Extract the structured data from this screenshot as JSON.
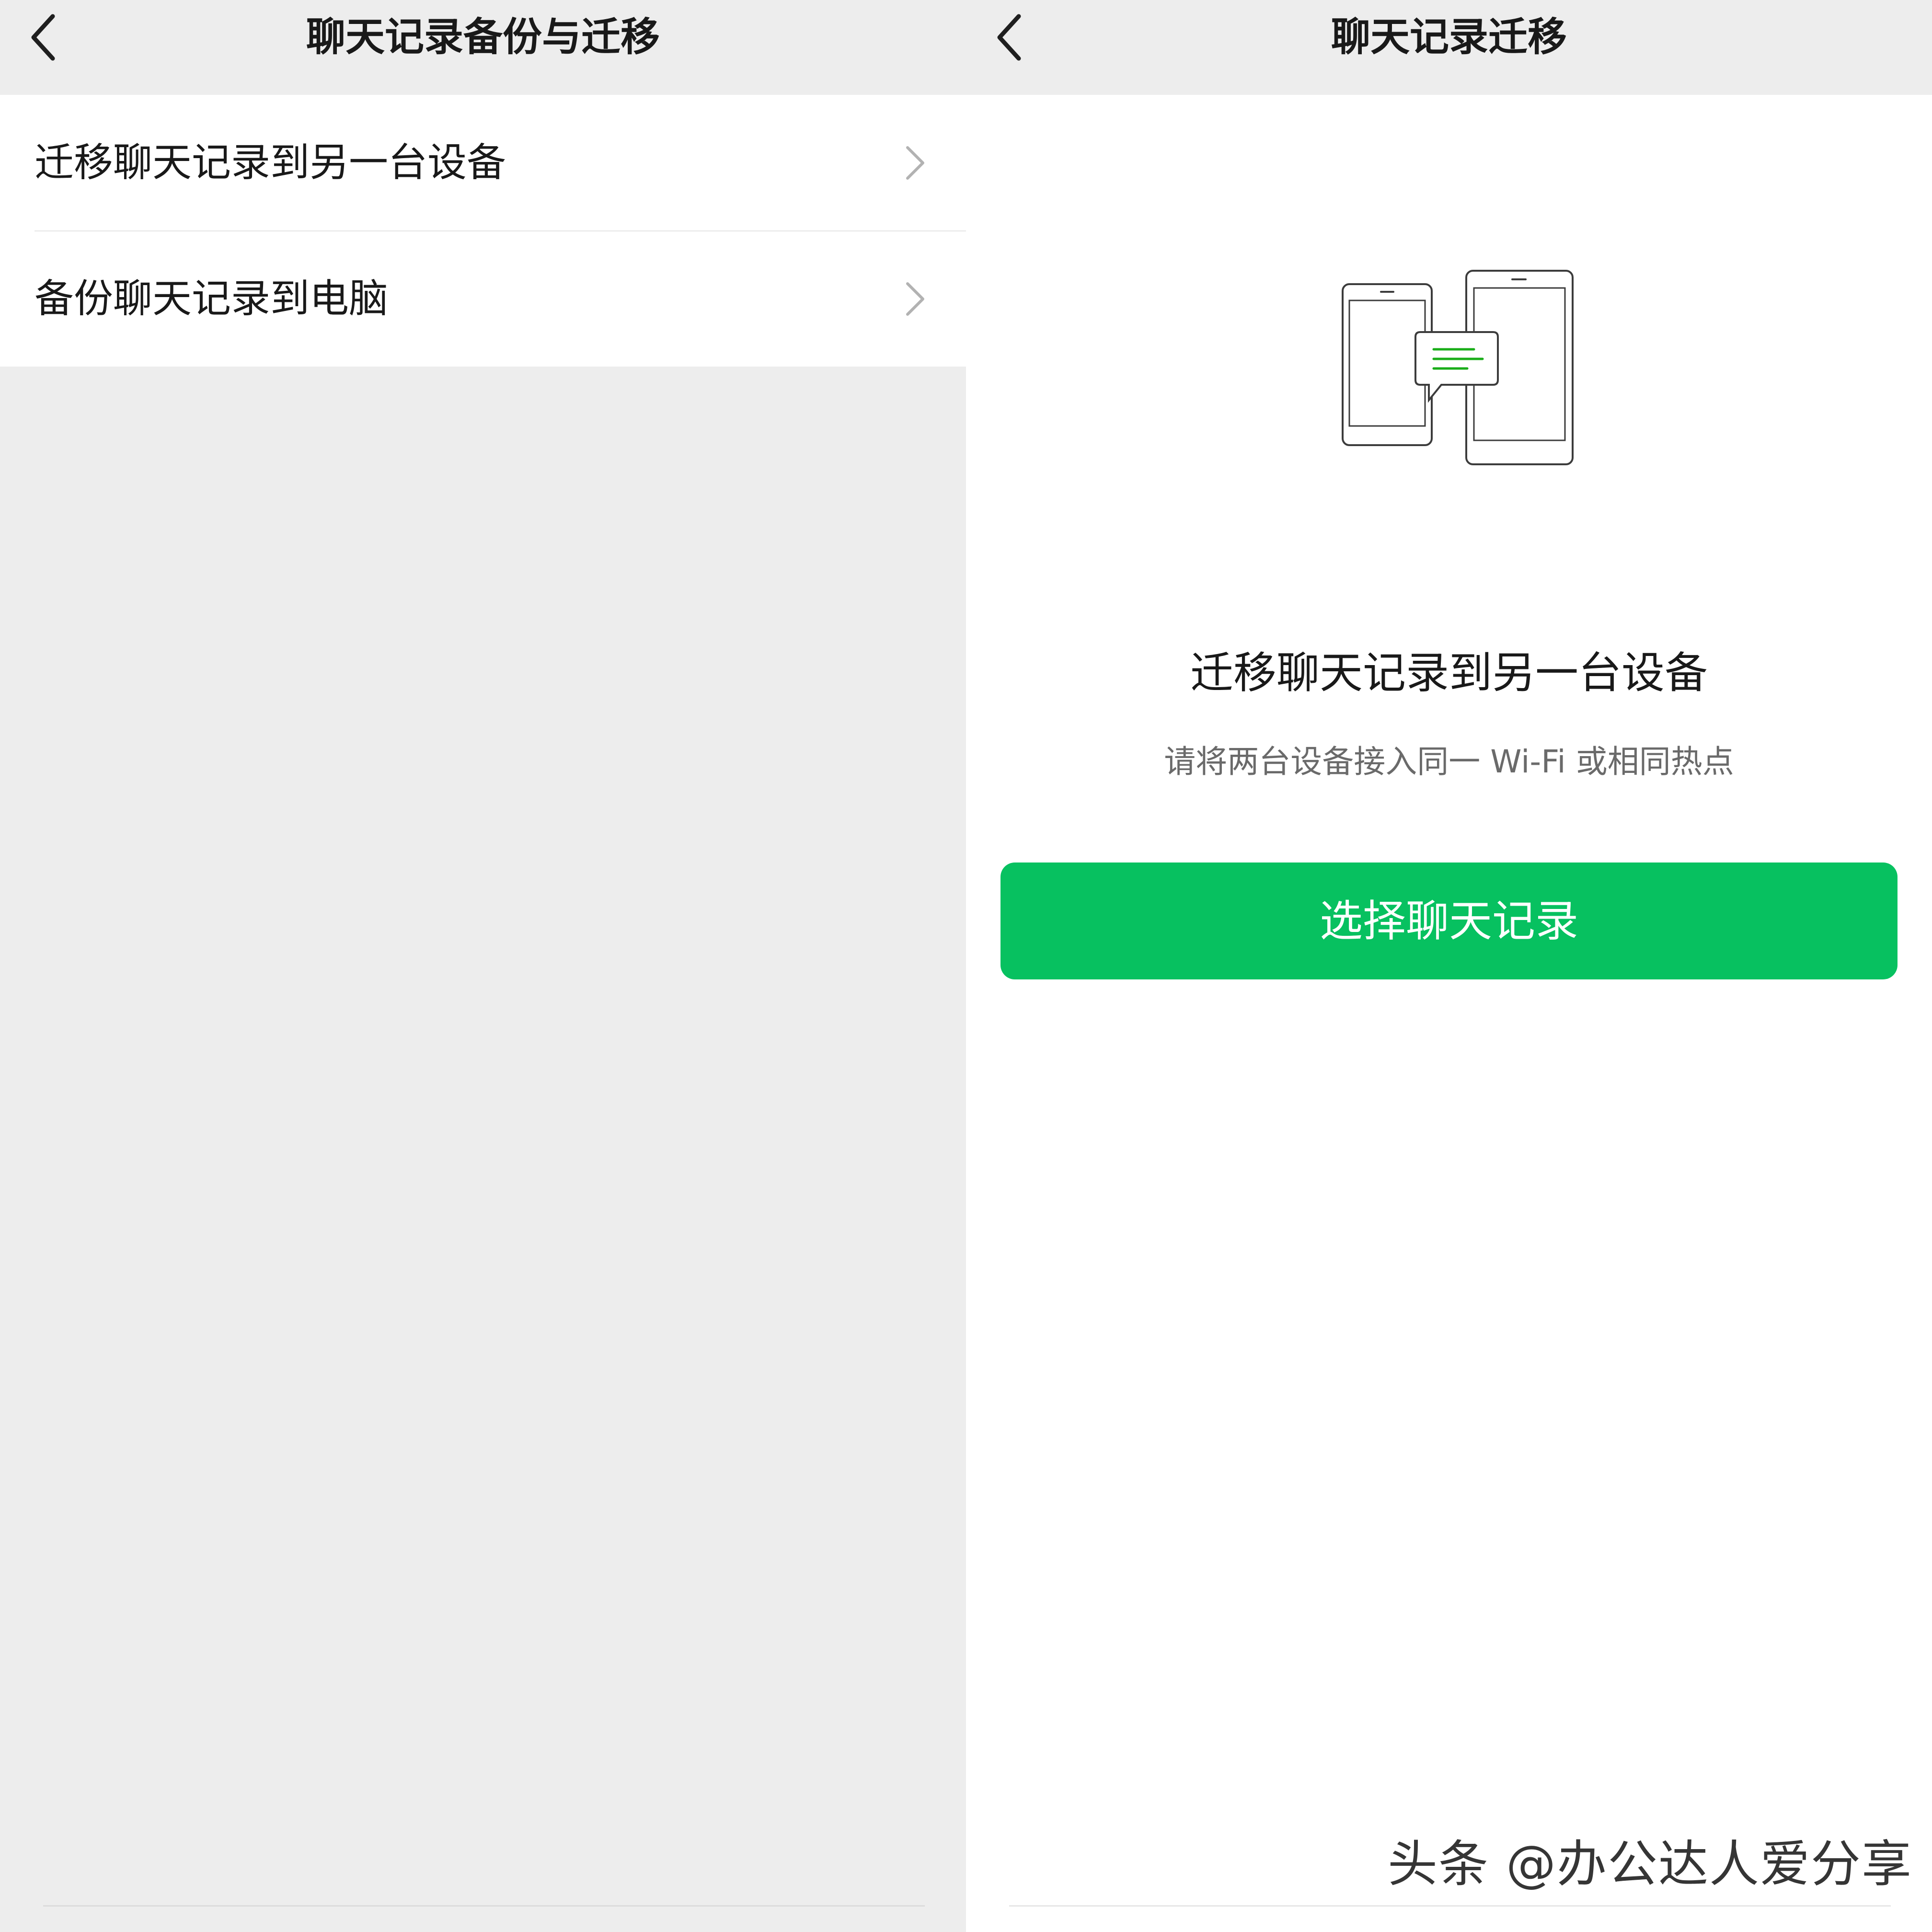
{
  "left_screen": {
    "nav": {
      "back_icon": "chevron-left-icon",
      "title": "聊天记录备份与迁移"
    },
    "menu": {
      "items": [
        {
          "label": "迁移聊天记录到另一台设备",
          "icon": "chevron-right-icon"
        },
        {
          "label": "备份聊天记录到电脑",
          "icon": "chevron-right-icon"
        }
      ]
    }
  },
  "right_screen": {
    "nav": {
      "back_icon": "chevron-left-icon",
      "title": "聊天记录迁移"
    },
    "illustration": {
      "icon": "phones-transfer-icon",
      "accent_color": "#1aad19"
    },
    "heading": "迁移聊天记录到另一台设备",
    "subtitle": "请将两台设备接入同一 Wi-Fi 或相同热点",
    "primary_button": {
      "label": "选择聊天记录",
      "color": "#07c160"
    },
    "watermark": "头条 @办公达人爱分享"
  }
}
